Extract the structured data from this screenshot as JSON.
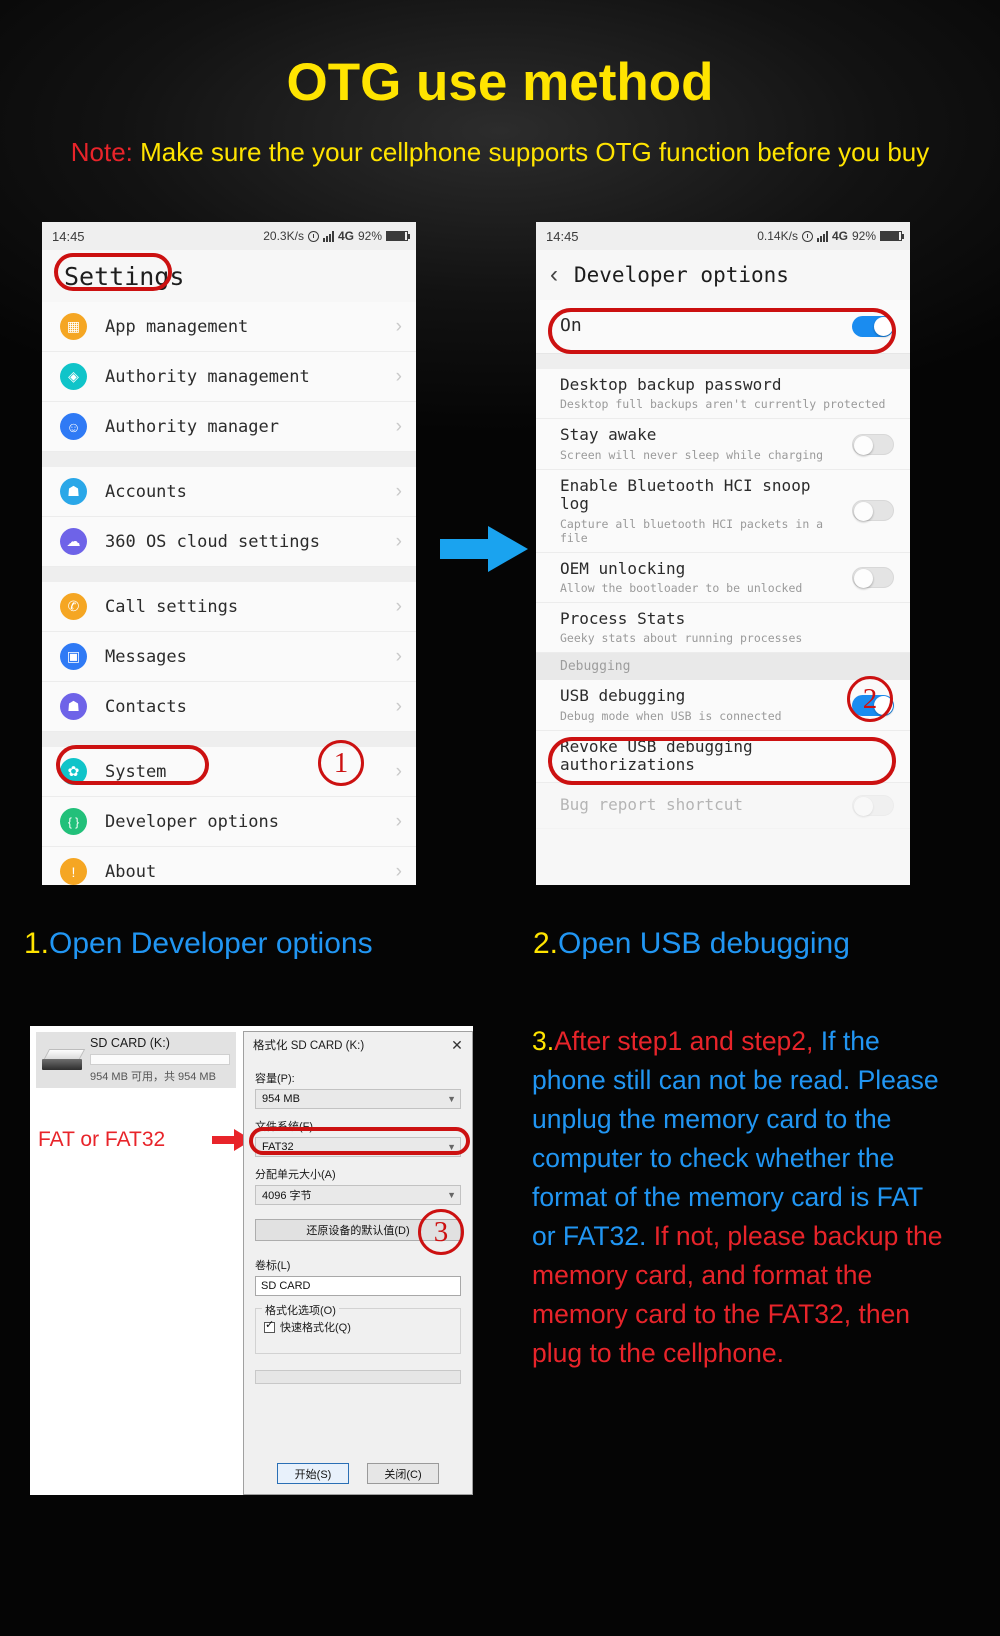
{
  "header": {
    "title": "OTG use method",
    "note_keyword": "Note:",
    "note_text": " Make sure the your cellphone supports OTG function before you buy"
  },
  "phone_left": {
    "status_bar": {
      "time": "14:45",
      "net_speed": "20.3K/s",
      "alarm_icon": "alarm-icon",
      "signal_icon": "signal-bars-icon",
      "network": "4G",
      "battery_percent": "92%",
      "battery_icon": "battery-icon"
    },
    "screen_title": "Settings",
    "groups": [
      {
        "items": [
          {
            "label": "App management",
            "icon": "apps-grid-icon",
            "color": "#f5a623"
          },
          {
            "label": "Authority management",
            "icon": "shield-icon",
            "color": "#10c4c9"
          },
          {
            "label": "Authority manager",
            "icon": "android-face-icon",
            "color": "#2f7af5"
          }
        ]
      },
      {
        "items": [
          {
            "label": "Accounts",
            "icon": "person-icon",
            "color": "#2aa7e8"
          },
          {
            "label": "360 OS cloud settings",
            "icon": "cloud-icon",
            "color": "#6e63e8"
          }
        ]
      },
      {
        "items": [
          {
            "label": "Call settings",
            "icon": "phone-icon",
            "color": "#f5a623"
          },
          {
            "label": "Messages",
            "icon": "message-icon",
            "color": "#2f7af5"
          },
          {
            "label": "Contacts",
            "icon": "person-icon",
            "color": "#6e63e8"
          }
        ]
      },
      {
        "items": [
          {
            "label": "System",
            "icon": "gear-icon",
            "color": "#10c4c9"
          },
          {
            "label": "Developer options",
            "icon": "braces-icon",
            "color": "#22c07a"
          },
          {
            "label": "About",
            "icon": "info-icon",
            "color": "#f5a623"
          }
        ]
      }
    ],
    "chevron": "›",
    "marker_number": "①"
  },
  "phone_right": {
    "status_bar": {
      "time": "14:45",
      "net_speed": "0.14K/s",
      "alarm_icon": "alarm-icon",
      "signal_icon": "signal-bars-icon",
      "network": "4G",
      "battery_percent": "92%",
      "battery_icon": "battery-icon"
    },
    "back_icon": "chevron-left-icon",
    "screen_title": "Developer options",
    "master_toggle": {
      "label": "On",
      "state": "on"
    },
    "rows": [
      {
        "title": "Desktop backup password",
        "subtitle": "Desktop full backups aren't currently protected",
        "toggle": "none"
      },
      {
        "title": "Stay awake",
        "subtitle": "Screen will never sleep while charging",
        "toggle": "off"
      },
      {
        "title": "Enable Bluetooth HCI snoop log",
        "subtitle": "Capture all bluetooth HCI packets in a file",
        "toggle": "off"
      },
      {
        "title": "OEM unlocking",
        "subtitle": "Allow the bootloader to be unlocked",
        "toggle": "off"
      },
      {
        "title": "Process Stats",
        "subtitle": "Geeky stats about running processes",
        "toggle": "none"
      }
    ],
    "section_header": "Debugging",
    "rows_debug": [
      {
        "title": "USB debugging",
        "subtitle": "Debug mode when USB is connected",
        "toggle": "on"
      },
      {
        "title": "Revoke USB debugging authorizations",
        "subtitle": "",
        "toggle": "none"
      },
      {
        "title": "Bug report shortcut",
        "subtitle": "",
        "toggle": "off"
      }
    ],
    "marker_number": "②"
  },
  "captions": {
    "step1_num": "1.",
    "step1_text": "Open Developer options",
    "step2_num": "2.",
    "step2_text": "Open USB debugging"
  },
  "windows": {
    "drive": {
      "name": "SD CARD (K:)",
      "free_text": "954 MB 可用，共 954 MB",
      "icon": "removable-drive-icon"
    },
    "fat_label": "FAT or FAT32",
    "arrow_icon": "red-arrow-right-icon",
    "dialog": {
      "title": "格式化 SD CARD (K:)",
      "close_icon": "close-icon",
      "capacity_label": "容量(P):",
      "capacity_value": "954 MB",
      "filesystem_label": "文件系统(F)",
      "filesystem_value": "FAT32",
      "allocation_label": "分配单元大小(A)",
      "allocation_value": "4096 字节",
      "restore_defaults_button": "还原设备的默认值(D)",
      "volume_label": "卷标(L)",
      "volume_value": "SD CARD",
      "options_legend": "格式化选项(O)",
      "quick_format_label": "快速格式化(Q)",
      "quick_format_checked": true,
      "start_button": "开始(S)",
      "close_button": "关闭(C)",
      "dropdown_arrow": "chevron-down-icon"
    },
    "marker_number": "③"
  },
  "step3": {
    "num": "3.",
    "red_lead": "After step1 and step2,",
    "blue_body": "If the phone still can not be read. Please unplug the memory card to the computer to check whether the format of the memory card is FAT or FAT32.",
    "red_tail": "If not, please backup the memory card, and format the memory card to the FAT32, then plug to the cellphone."
  },
  "colors": {
    "title_yellow": "#ffe400",
    "accent_red": "#e8242a",
    "accent_blue": "#2196f3",
    "toggle_on": "#1a8cf0",
    "oval_red": "#cc1111"
  }
}
